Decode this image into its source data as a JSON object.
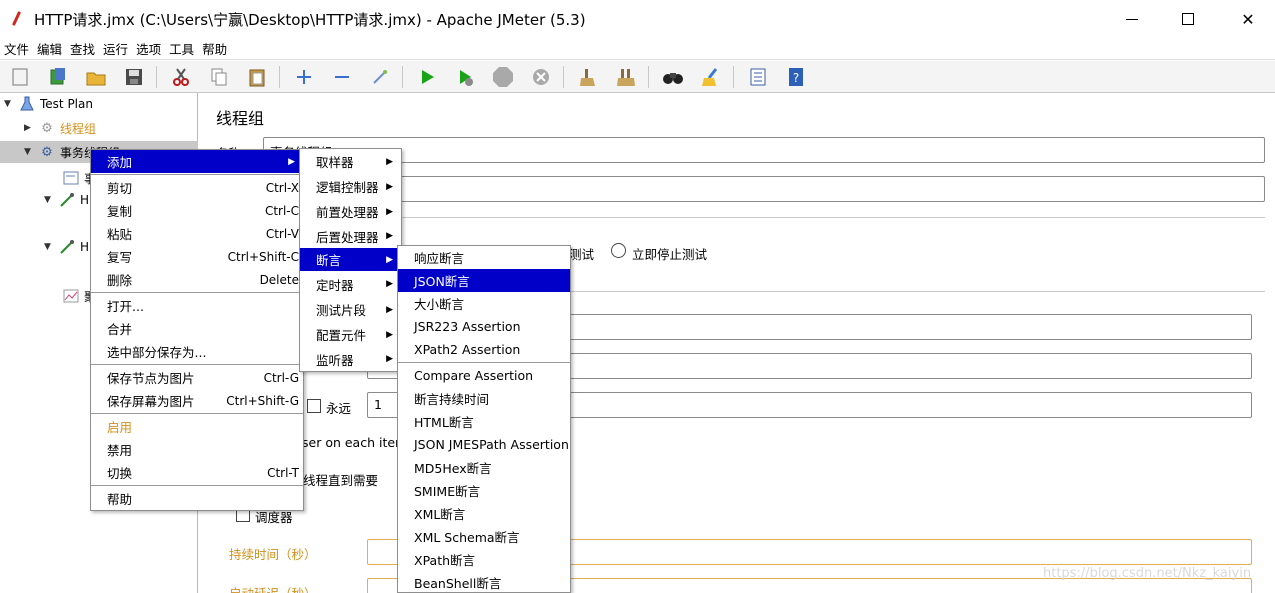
{
  "window": {
    "title": "HTTP请求.jmx (C:\\Users\\宁赢\\Desktop\\HTTP请求.jmx) - Apache JMeter (5.3)"
  },
  "menubar": [
    "文件",
    "编辑",
    "查找",
    "运行",
    "选项",
    "工具",
    "帮助"
  ],
  "toolbar": {
    "icons": [
      "new-icon",
      "templates-icon",
      "open-icon",
      "save-icon",
      "cut-icon",
      "copy-icon",
      "paste-icon",
      "expand-icon",
      "collapse-icon",
      "toggle-icon",
      "start-icon",
      "start-no-pause-icon",
      "stop-icon",
      "shutdown-icon",
      "clear-icon",
      "clear-all-icon",
      "search-icon",
      "reset-search-icon",
      "function-helper-icon",
      "help-icon"
    ]
  },
  "tree": {
    "items": [
      {
        "label": "Test Plan"
      },
      {
        "label": "线程组"
      },
      {
        "label": "事务线程组"
      },
      {
        "label": "事"
      },
      {
        "label": "H"
      },
      {
        "label": "H"
      },
      {
        "label": "聚"
      }
    ]
  },
  "pane": {
    "title": "线程组",
    "name_label": "名称:",
    "name_value": "事务线程组",
    "radio_text_1": "测试",
    "radio_text_2": "立即停止测试",
    "forever_label": "永远",
    "loop_value": "1",
    "same_user_text": "ser on each iterati",
    "delay_text": "线程直到需要",
    "scheduler_label": "调度器",
    "duration_label": "持续时间（秒）",
    "startup_delay_label": "启动延迟（秒）"
  },
  "context_menu": {
    "items": [
      {
        "label": "添加",
        "submenu": true
      },
      {
        "label": "剪切",
        "accel": "Ctrl-X"
      },
      {
        "label": "复制",
        "accel": "Ctrl-C"
      },
      {
        "label": "粘贴",
        "accel": "Ctrl-V"
      },
      {
        "label": "复写",
        "accel": "Ctrl+Shift-C"
      },
      {
        "label": "删除",
        "accel": "Delete"
      },
      {
        "label": "打开..."
      },
      {
        "label": "合并"
      },
      {
        "label": "选中部分保存为..."
      },
      {
        "label": "保存节点为图片",
        "accel": "Ctrl-G"
      },
      {
        "label": "保存屏幕为图片",
        "accel": "Ctrl+Shift-G"
      },
      {
        "label": "启用"
      },
      {
        "label": "禁用"
      },
      {
        "label": "切换",
        "accel": "Ctrl-T"
      },
      {
        "label": "帮助"
      }
    ]
  },
  "add_submenu": {
    "items": [
      {
        "label": "取样器"
      },
      {
        "label": "逻辑控制器"
      },
      {
        "label": "前置处理器"
      },
      {
        "label": "后置处理器"
      },
      {
        "label": "断言"
      },
      {
        "label": "定时器"
      },
      {
        "label": "测试片段"
      },
      {
        "label": "配置元件"
      },
      {
        "label": "监听器"
      }
    ]
  },
  "assertion_submenu": {
    "items": [
      {
        "label": "响应断言"
      },
      {
        "label": "JSON断言"
      },
      {
        "label": "大小断言"
      },
      {
        "label": "JSR223 Assertion"
      },
      {
        "label": "XPath2 Assertion"
      },
      {
        "label": "Compare Assertion"
      },
      {
        "label": "断言持续时间"
      },
      {
        "label": "HTML断言"
      },
      {
        "label": "JSON JMESPath Assertion"
      },
      {
        "label": "MD5Hex断言"
      },
      {
        "label": "SMIME断言"
      },
      {
        "label": "XML断言"
      },
      {
        "label": "XML Schema断言"
      },
      {
        "label": "XPath断言"
      },
      {
        "label": "BeanShell断言"
      }
    ]
  },
  "watermark": "https://blog.csdn.net/Nkz_kaiyin"
}
